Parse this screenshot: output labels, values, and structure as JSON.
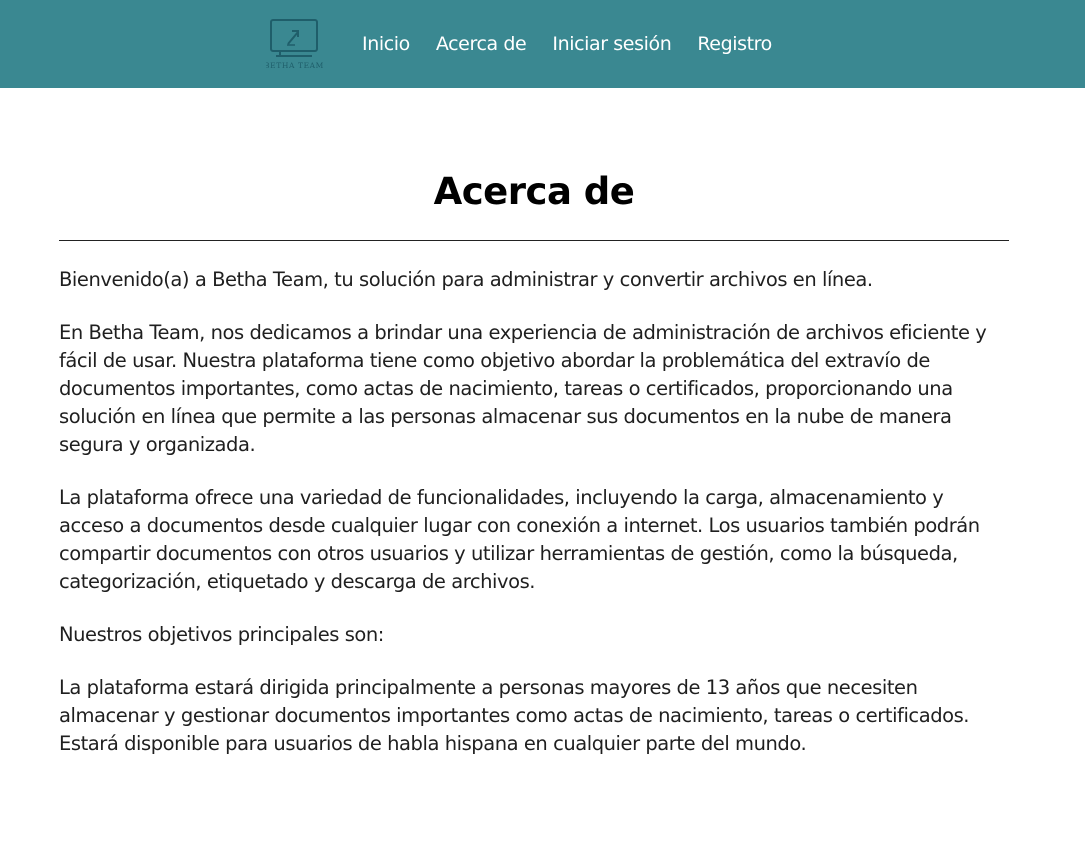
{
  "header": {
    "logo_text": "BETHA TEAM",
    "nav": [
      {
        "label": "Inicio"
      },
      {
        "label": "Acerca de"
      },
      {
        "label": "Iniciar sesión"
      },
      {
        "label": "Registro"
      }
    ]
  },
  "main": {
    "title": "Acerca de",
    "paragraphs": [
      "Bienvenido(a) a Betha Team, tu solución para administrar y convertir archivos en línea.",
      "En Betha Team, nos dedicamos a brindar una experiencia de administración de archivos eficiente y fácil de usar. Nuestra plataforma tiene como objetivo abordar la problemática del extravío de documentos importantes, como actas de nacimiento, tareas o certificados, proporcionando una solución en línea que permite a las personas almacenar sus documentos en la nube de manera segura y organizada.",
      "La plataforma ofrece una variedad de funcionalidades, incluyendo la carga, almacenamiento y acceso a documentos desde cualquier lugar con conexión a internet. Los usuarios también podrán compartir documentos con otros usuarios y utilizar herramientas de gestión, como la búsqueda, categorización, etiquetado y descarga de archivos.",
      "Nuestros objetivos principales son:",
      "La plataforma estará dirigida principalmente a personas mayores de 13 años que necesiten almacenar y gestionar documentos importantes como actas de nacimiento, tareas o certificados. Estará disponible para usuarios de habla hispana en cualquier parte del mundo."
    ]
  },
  "colors": {
    "navbar": "#3a8891",
    "logo": "#1f5e6a",
    "nav_text": "#ffffff"
  }
}
